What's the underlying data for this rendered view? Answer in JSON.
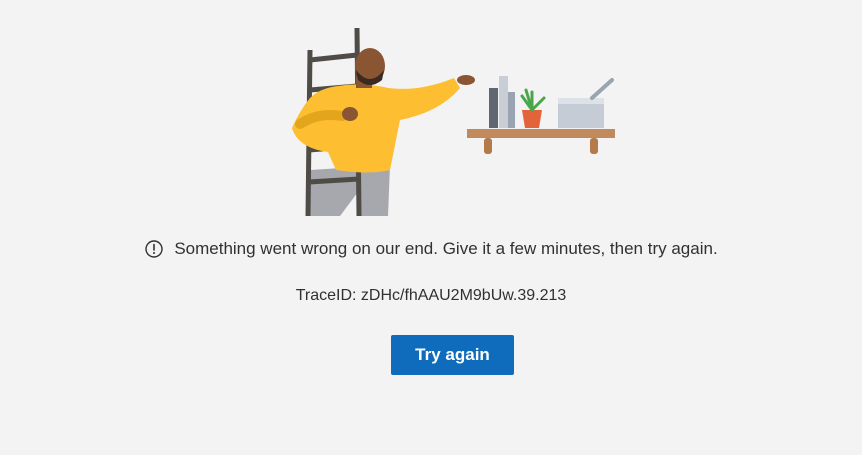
{
  "error": {
    "message": "Something went wrong on our end. Give it a few minutes, then try again.",
    "trace_id": "TraceID: zDHc/fhAAU2M9bUw.39.213",
    "retry_label": "Try again",
    "icon": "info-icon"
  },
  "colors": {
    "background": "#f3f3f3",
    "button": "#0f6cbd",
    "text": "#323130"
  }
}
